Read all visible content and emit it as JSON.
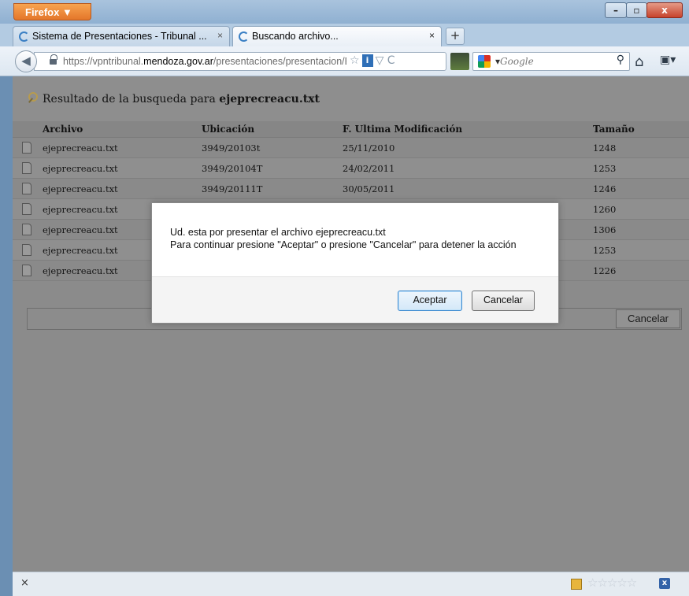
{
  "browser": {
    "menu_button": "Firefox ▼",
    "window_controls": {
      "minimize": "–",
      "maximize": "▫",
      "close": "x"
    },
    "tabs": [
      {
        "label": "Sistema de Presentaciones - Tribunal ...",
        "close": "×"
      },
      {
        "label": "Buscando archivo...",
        "close": "×",
        "active": true
      }
    ],
    "new_tab": "+",
    "url": {
      "prefix": "https://vpntribunal.",
      "domain": "mendoza.gov.ar",
      "path": "/presentaciones/presentacion/Bu"
    },
    "url_icons": "☆",
    "url_icons_2": "▽ C",
    "search": {
      "placeholder": "Google",
      "icon": "search-icon"
    },
    "home_icon": "⌂",
    "bookmark_icon": "▣▾"
  },
  "results": {
    "title_prefix": "Resultado de la busqueda para ",
    "title_term": "ejeprecreacu.txt",
    "columns": [
      "Archivo",
      "Ubicación",
      "F. Ultima Modificación",
      "Tamaño"
    ],
    "rows": [
      {
        "archivo": "ejeprecreacu.txt",
        "ubicacion": "3949/20103t",
        "fecha": "25/11/2010",
        "tamano": "1248"
      },
      {
        "archivo": "ejeprecreacu.txt",
        "ubicacion": "3949/20104T",
        "fecha": "24/02/2011",
        "tamano": "1253"
      },
      {
        "archivo": "ejeprecreacu.txt",
        "ubicacion": "3949/20111T",
        "fecha": "30/05/2011",
        "tamano": "1246"
      },
      {
        "archivo": "ejeprecreacu.txt",
        "ubicacion": "",
        "fecha": "",
        "tamano": "1260"
      },
      {
        "archivo": "ejeprecreacu.txt",
        "ubicacion": "",
        "fecha": "",
        "tamano": "1306"
      },
      {
        "archivo": "ejeprecreacu.txt",
        "ubicacion": "",
        "fecha": "",
        "tamano": "1253"
      },
      {
        "archivo": "ejeprecreacu.txt",
        "ubicacion": "",
        "fecha": "",
        "tamano": "1226"
      }
    ],
    "cancel_button": "Cancelar"
  },
  "dialog": {
    "line1": "Ud. esta por presentar el archivo  ejeprecreacu.txt",
    "line2": "Para continuar presione \"Aceptar\" o presione \"Cancelar\" para detener la acción",
    "ok_label": "Aceptar",
    "cancel_label": "Cancelar"
  },
  "statusbar": {
    "close": "×",
    "rating": "☆☆☆☆☆",
    "x_icon": "x"
  }
}
